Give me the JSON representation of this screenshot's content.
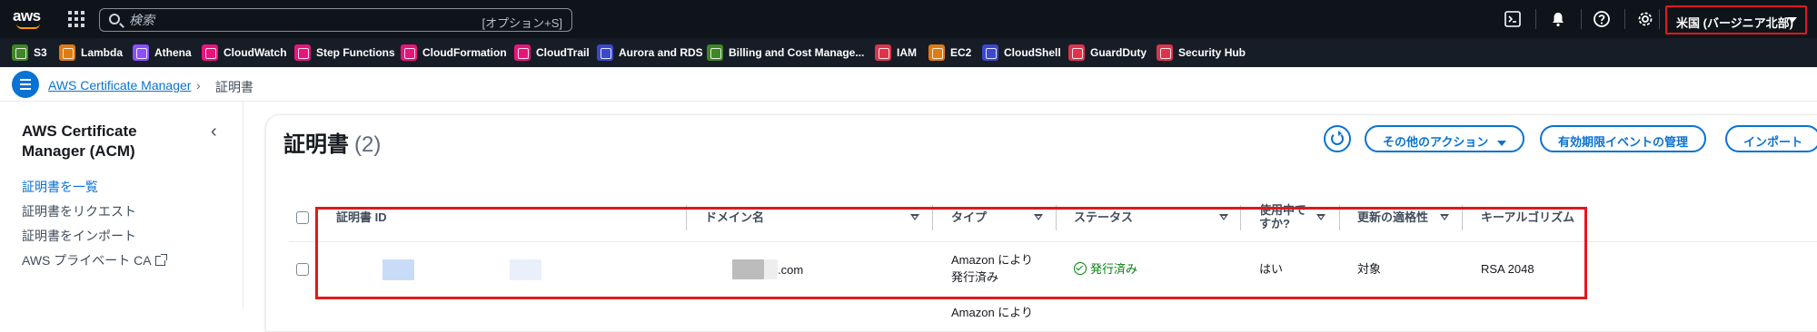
{
  "topnav": {
    "search_placeholder": "検索",
    "search_shortcut": "[オプション+S]",
    "region": "米国 (バージニア北部)"
  },
  "favorites": [
    {
      "label": "S3",
      "color": "#3f8624",
      "icon": "s3-icon"
    },
    {
      "label": "Lambda",
      "color": "#e07b12",
      "icon": "lambda-icon"
    },
    {
      "label": "Athena",
      "color": "#8c4fff",
      "icon": "athena-icon"
    },
    {
      "label": "CloudWatch",
      "color": "#e7157b",
      "icon": "cloudwatch-icon"
    },
    {
      "label": "Step Functions",
      "color": "#e7157b",
      "icon": "step-functions-icon"
    },
    {
      "label": "CloudFormation",
      "color": "#e7157b",
      "icon": "cloudformation-icon"
    },
    {
      "label": "CloudTrail",
      "color": "#e7157b",
      "icon": "cloudtrail-icon"
    },
    {
      "label": "Aurora and RDS",
      "color": "#3b48cc",
      "icon": "rds-icon"
    },
    {
      "label": "Billing and Cost Manage...",
      "color": "#3f8624",
      "icon": "billing-icon"
    },
    {
      "label": "IAM",
      "color": "#dd344c",
      "icon": "iam-icon"
    },
    {
      "label": "EC2",
      "color": "#e07b12",
      "icon": "ec2-icon"
    },
    {
      "label": "CloudShell",
      "color": "#3b48cc",
      "icon": "cloudshell-icon"
    },
    {
      "label": "GuardDuty",
      "color": "#dd344c",
      "icon": "guardduty-icon"
    },
    {
      "label": "Security Hub",
      "color": "#dd344c",
      "icon": "security-hub-icon"
    }
  ],
  "breadcrumb": {
    "root": "AWS Certificate Manager",
    "current": "証明書"
  },
  "sidenav": {
    "title": "AWS Certificate Manager (ACM)",
    "items": [
      {
        "label": "証明書を一覧",
        "active": true
      },
      {
        "label": "証明書をリクエスト",
        "active": false
      },
      {
        "label": "証明書をインポート",
        "active": false
      },
      {
        "label": "AWS プライベート CA",
        "active": false
      }
    ]
  },
  "page": {
    "title": "証明書",
    "count": "(2)"
  },
  "actions": {
    "more_actions": "その他のアクション",
    "manage_expiry": "有効期限イベントの管理",
    "import": "インポート"
  },
  "table": {
    "columns": [
      {
        "label": "証明書 ID"
      },
      {
        "label": "ドメイン名"
      },
      {
        "label": "タイプ"
      },
      {
        "label": "ステータス"
      },
      {
        "label": "使用中で すか?"
      },
      {
        "label": "更新の適格性"
      },
      {
        "label": "キーアルゴリズム"
      }
    ],
    "rows": [
      {
        "domain_suffix": ".com",
        "type_line1": "Amazon により",
        "type_line2": "発行済み",
        "status": "発行済み",
        "in_use": "はい",
        "renewal": "対象",
        "key_algorithm": "RSA 2048"
      },
      {
        "type_line1": "Amazon により"
      }
    ]
  },
  "colors": {
    "accent": "#0972d3",
    "highlight": "#e0191b",
    "success": "#037f0c"
  }
}
